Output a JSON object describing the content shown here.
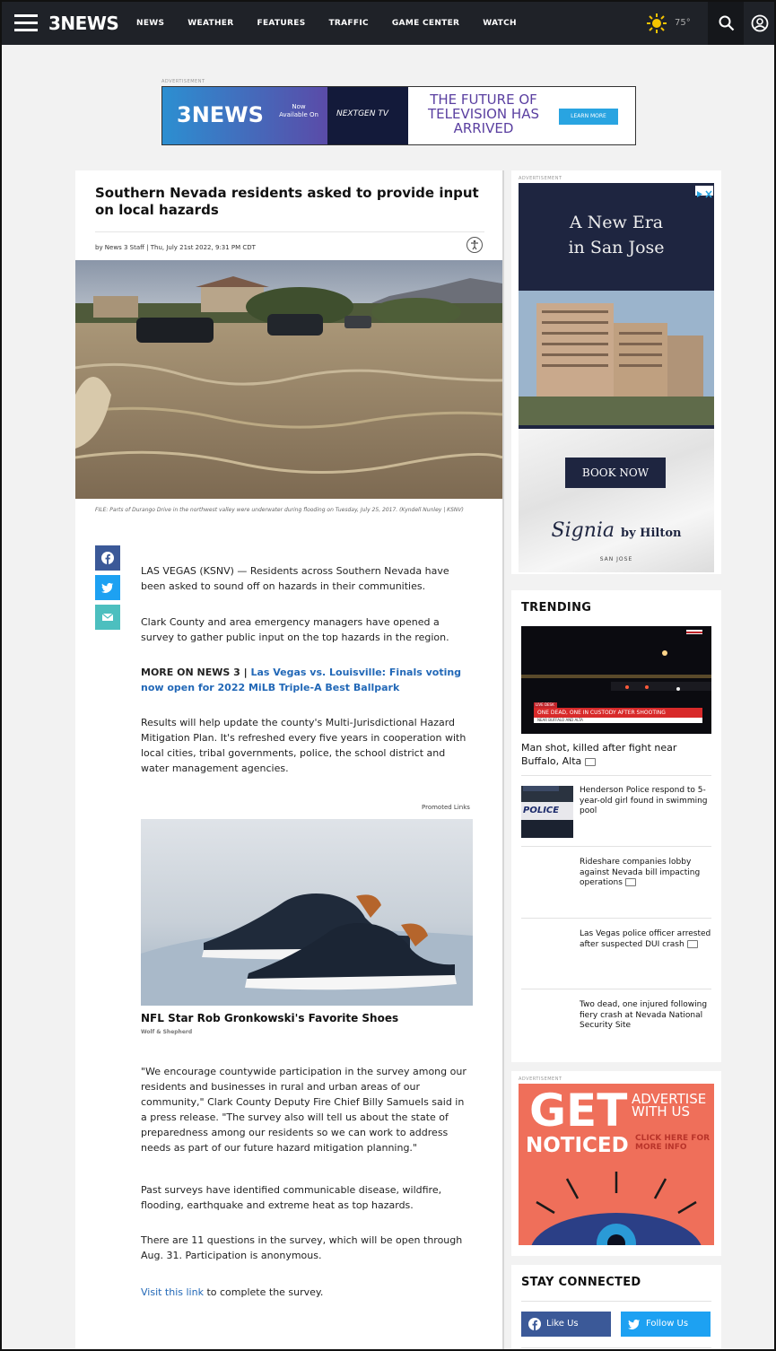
{
  "nav": {
    "logo": "3NEWS",
    "menu": [
      "NEWS",
      "WEATHER",
      "FEATURES",
      "TRAFFIC",
      "GAME CENTER",
      "WATCH"
    ],
    "temperature": "75°",
    "colors": {
      "bar": "#1f2228",
      "accent": "#f5c400"
    }
  },
  "top_ad": {
    "label": "ADVERTISEMENT",
    "logo": "3NEWS",
    "now_available": "Now Available On",
    "brand": "NEXTGEN TV",
    "headline": "THE FUTURE OF TELEVISION HAS ARRIVED",
    "cta": "LEARN MORE"
  },
  "article": {
    "headline": "Southern Nevada residents asked to provide input on local hazards",
    "byline": "by News 3 Staff | Thu, July 21st 2022, 9:31 PM CDT",
    "caption": "FILE: Parts of Durango Drive in the northwest valley were underwater during flooding on Tuesday, July 25, 2017. (Kyndell Nunley | KSNV)",
    "p1": "LAS VEGAS (KSNV) — Residents across Southern Nevada have been asked to sound off on hazards in their communities.",
    "p2": "Clark County and area emergency managers have opened a survey to gather public input on the top hazards in the region.",
    "more_label": "MORE ON NEWS 3 | ",
    "more_link": "Las Vegas vs. Louisville: Finals voting now open for 2022 MiLB Triple-A Best Ballpark",
    "p3": "Results will help update the county's Multi-Jurisdictional Hazard Mitigation Plan. It's refreshed every five years in cooperation with local cities, tribal governments, police, the school district and water management agencies.",
    "promoted_label": "Promoted Links",
    "promo_title": "NFL Star Rob Gronkowski's Favorite Shoes",
    "promo_source": "Wolf & Shepherd",
    "p4": "\"We encourage countywide participation in the survey among our residents and businesses in rural and urban areas of our community,\" Clark County Deputy Fire Chief Billy Samuels said in a press release. \"The survey also will tell us about the state of preparedness among our residents so we can work to address needs as part of our future hazard mitigation planning.\"",
    "p5": "Past surveys have identified communicable disease, wildfire, flooding, earthquake and extreme heat as top hazards.",
    "p6": "There are 11 questions in the survey, which will be open through Aug. 31. Participation is anonymous.",
    "p7_link": "Visit this link",
    "p7_rest": " to complete the survey."
  },
  "side_ad": {
    "label": "ADVERTISEMENT",
    "headline_1": "A New Era",
    "headline_2": "in San Jose",
    "cta": "BOOK NOW",
    "brand": "Signia",
    "brand_sub": "by Hilton",
    "location": "SAN JOSE"
  },
  "trending": {
    "title": "TRENDING",
    "lower_third": "ONE DEAD, ONE IN CUSTODY AFTER SHOOTING",
    "lower_third_sub": "NEAR BUFFALO AND ALTA",
    "lower_third_tag": "LIVE DESK",
    "main_headline": "Man shot, killed after fight near Buffalo, Alta",
    "items": [
      {
        "text": "Henderson Police respond to 5-year-old girl found in swimming pool",
        "thumb_label": "POLICE"
      },
      {
        "text": "Rideshare companies lobby against Nevada bill impacting operations"
      },
      {
        "text": "Las Vegas police officer arrested after suspected DUI crash"
      },
      {
        "text": "Two dead, one injured following fiery crash at Nevada National Security Site"
      }
    ]
  },
  "get_noticed_ad": {
    "label": "ADVERTISEMENT",
    "get": "GET",
    "noticed": "NOTICED",
    "advertise": "ADVERTISE WITH US",
    "click": "CLICK HERE FOR MORE INFO"
  },
  "stay_connected": {
    "title": "STAY CONNECTED",
    "like": "Like Us",
    "follow": "Follow Us"
  }
}
